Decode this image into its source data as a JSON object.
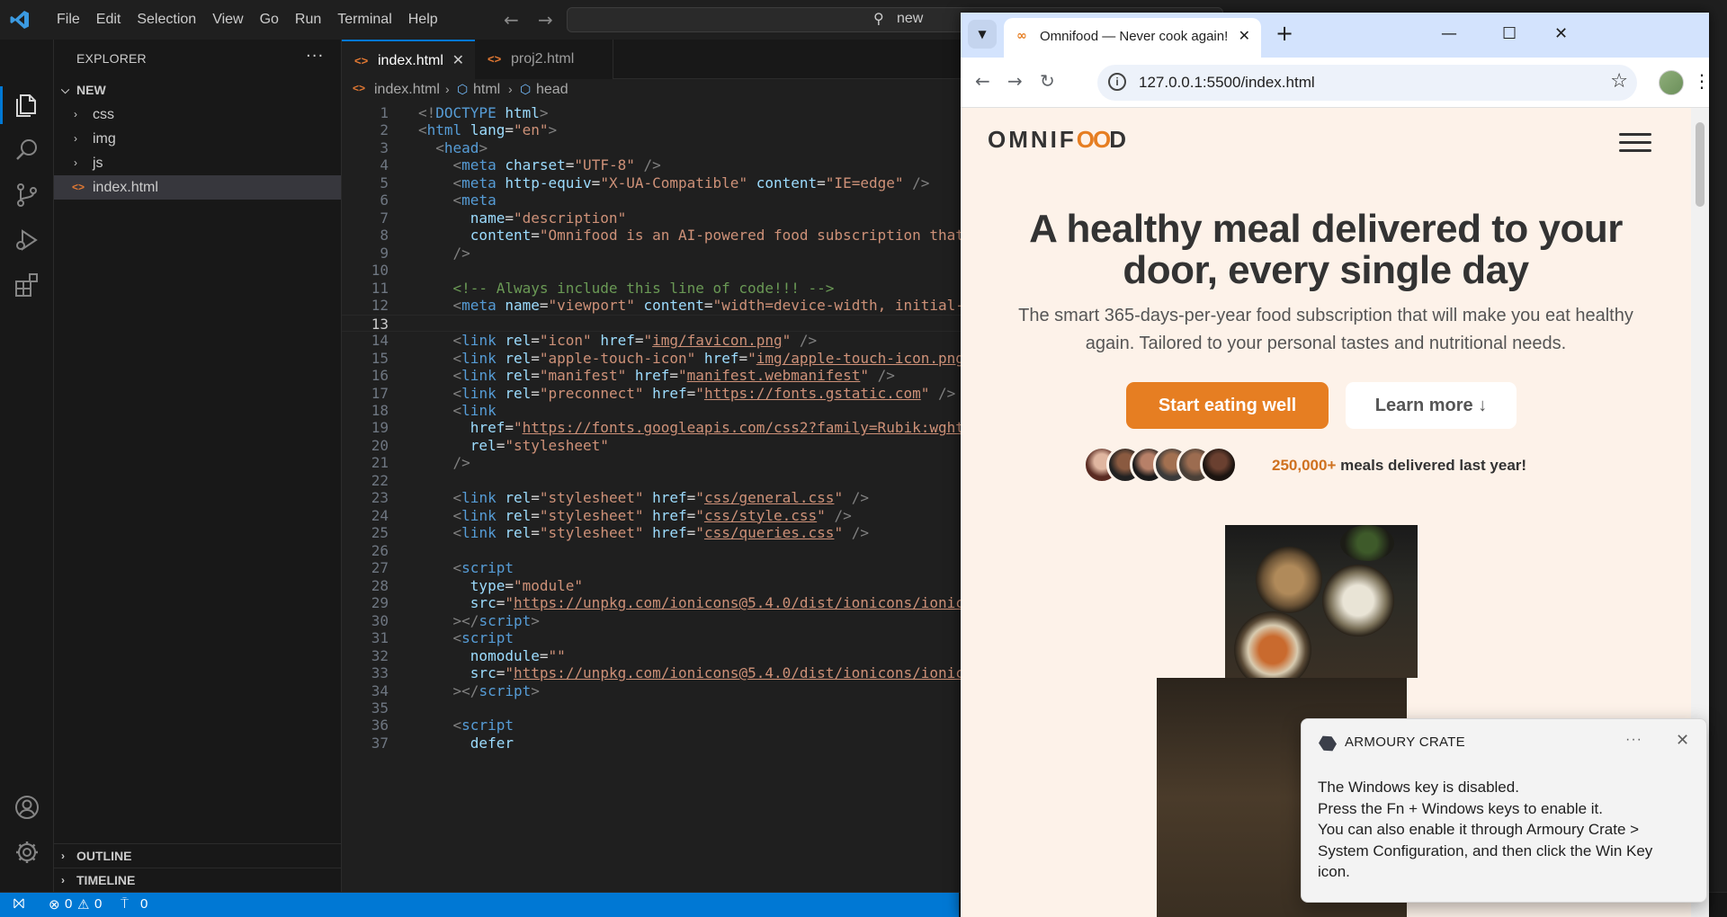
{
  "vscode": {
    "menu": [
      "File",
      "Edit",
      "Selection",
      "View",
      "Go",
      "Run",
      "Terminal",
      "Help"
    ],
    "search_text": "new",
    "explorer_title": "EXPLORER",
    "explorer_more": "···",
    "root_folder": "NEW",
    "tree": [
      {
        "label": "css",
        "type": "folder"
      },
      {
        "label": "img",
        "type": "folder"
      },
      {
        "label": "js",
        "type": "folder"
      },
      {
        "label": "index.html",
        "type": "file"
      }
    ],
    "outline": "OUTLINE",
    "timeline": "TIMELINE",
    "tabs": [
      {
        "label": "index.html",
        "active": true
      },
      {
        "label": "proj2.html",
        "active": false
      }
    ],
    "breadcrumb": [
      "index.html",
      "html",
      "head"
    ],
    "current_line": 13,
    "status": {
      "errors": "0",
      "warnings": "0",
      "ports": "0"
    }
  },
  "browser": {
    "tab_title": "Omnifood — Never cook again!",
    "url": "127.0.0.1:5500/index.html",
    "page": {
      "logo_left": "OMNIF",
      "logo_oo": "OO",
      "logo_right": "D",
      "hero_title": "A healthy meal delivered to your door, every single day",
      "hero_description": "The smart 365-days-per-year food subscription that will make you eat healthy again. Tailored to your personal tastes and nutritional needs.",
      "cta_primary": "Start eating well",
      "cta_secondary": "Learn more ↓",
      "delivered_number": "250,000+",
      "delivered_text": " meals delivered last year!",
      "customer_count": 6
    }
  },
  "toast": {
    "app_name": "ARMOURY CRATE",
    "more": "···",
    "lines": [
      "The Windows key is disabled.",
      "Press the Fn + Windows keys to enable it.",
      "You can also enable it through Armoury Crate >",
      "System Configuration, and then click the Win Key",
      "icon."
    ]
  },
  "code_lines": [
    [
      [
        "t",
        "<!"
      ],
      [
        "n",
        "DOCTYPE"
      ],
      [
        "p",
        " "
      ],
      [
        "a",
        "html"
      ],
      [
        "t",
        ">"
      ]
    ],
    [
      [
        "t",
        "<"
      ],
      [
        "n",
        "html"
      ],
      [
        "p",
        " "
      ],
      [
        "a",
        "lang"
      ],
      [
        "p",
        "="
      ],
      [
        "s",
        "\"en\""
      ],
      [
        "t",
        ">"
      ]
    ],
    [
      [
        "p",
        "  "
      ],
      [
        "t",
        "<"
      ],
      [
        "n",
        "head"
      ],
      [
        "t",
        ">"
      ]
    ],
    [
      [
        "p",
        "    "
      ],
      [
        "t",
        "<"
      ],
      [
        "n",
        "meta"
      ],
      [
        "p",
        " "
      ],
      [
        "a",
        "charset"
      ],
      [
        "p",
        "="
      ],
      [
        "s",
        "\"UTF-8\""
      ],
      [
        "p",
        " "
      ],
      [
        "t",
        "/>"
      ]
    ],
    [
      [
        "p",
        "    "
      ],
      [
        "t",
        "<"
      ],
      [
        "n",
        "meta"
      ],
      [
        "p",
        " "
      ],
      [
        "a",
        "http-equiv"
      ],
      [
        "p",
        "="
      ],
      [
        "s",
        "\"X-UA-Compatible\""
      ],
      [
        "p",
        " "
      ],
      [
        "a",
        "content"
      ],
      [
        "p",
        "="
      ],
      [
        "s",
        "\"IE=edge\""
      ],
      [
        "p",
        " "
      ],
      [
        "t",
        "/>"
      ]
    ],
    [
      [
        "p",
        "    "
      ],
      [
        "t",
        "<"
      ],
      [
        "n",
        "meta"
      ]
    ],
    [
      [
        "p",
        "      "
      ],
      [
        "a",
        "name"
      ],
      [
        "p",
        "="
      ],
      [
        "s",
        "\"description\""
      ]
    ],
    [
      [
        "p",
        "      "
      ],
      [
        "a",
        "content"
      ],
      [
        "p",
        "="
      ],
      [
        "s",
        "\"Omnifood is an AI-powered food subscription that"
      ]
    ],
    [
      [
        "p",
        "    "
      ],
      [
        "t",
        "/>"
      ]
    ],
    [],
    [
      [
        "p",
        "    "
      ],
      [
        "c",
        "<!-- Always include this line of code!!! -->"
      ]
    ],
    [
      [
        "p",
        "    "
      ],
      [
        "t",
        "<"
      ],
      [
        "n",
        "meta"
      ],
      [
        "p",
        " "
      ],
      [
        "a",
        "name"
      ],
      [
        "p",
        "="
      ],
      [
        "s",
        "\"viewport\""
      ],
      [
        "p",
        " "
      ],
      [
        "a",
        "content"
      ],
      [
        "p",
        "="
      ],
      [
        "s",
        "\"width=device-width, initial-"
      ]
    ],
    [],
    [
      [
        "p",
        "    "
      ],
      [
        "t",
        "<"
      ],
      [
        "n",
        "link"
      ],
      [
        "p",
        " "
      ],
      [
        "a",
        "rel"
      ],
      [
        "p",
        "="
      ],
      [
        "s",
        "\"icon\""
      ],
      [
        "p",
        " "
      ],
      [
        "a",
        "href"
      ],
      [
        "p",
        "="
      ],
      [
        "s",
        "\""
      ],
      [
        "l",
        "img/favicon.png"
      ],
      [
        "s",
        "\""
      ],
      [
        "p",
        " "
      ],
      [
        "t",
        "/>"
      ]
    ],
    [
      [
        "p",
        "    "
      ],
      [
        "t",
        "<"
      ],
      [
        "n",
        "link"
      ],
      [
        "p",
        " "
      ],
      [
        "a",
        "rel"
      ],
      [
        "p",
        "="
      ],
      [
        "s",
        "\"apple-touch-icon\""
      ],
      [
        "p",
        " "
      ],
      [
        "a",
        "href"
      ],
      [
        "p",
        "="
      ],
      [
        "s",
        "\""
      ],
      [
        "l",
        "img/apple-touch-icon.png"
      ]
    ],
    [
      [
        "p",
        "    "
      ],
      [
        "t",
        "<"
      ],
      [
        "n",
        "link"
      ],
      [
        "p",
        " "
      ],
      [
        "a",
        "rel"
      ],
      [
        "p",
        "="
      ],
      [
        "s",
        "\"manifest\""
      ],
      [
        "p",
        " "
      ],
      [
        "a",
        "href"
      ],
      [
        "p",
        "="
      ],
      [
        "s",
        "\""
      ],
      [
        "l",
        "manifest.webmanifest"
      ],
      [
        "s",
        "\""
      ],
      [
        "p",
        " "
      ],
      [
        "t",
        "/>"
      ]
    ],
    [
      [
        "p",
        "    "
      ],
      [
        "t",
        "<"
      ],
      [
        "n",
        "link"
      ],
      [
        "p",
        " "
      ],
      [
        "a",
        "rel"
      ],
      [
        "p",
        "="
      ],
      [
        "s",
        "\"preconnect\""
      ],
      [
        "p",
        " "
      ],
      [
        "a",
        "href"
      ],
      [
        "p",
        "="
      ],
      [
        "s",
        "\""
      ],
      [
        "l",
        "https://fonts.gstatic.com"
      ],
      [
        "s",
        "\""
      ],
      [
        "p",
        " "
      ],
      [
        "t",
        "/>"
      ]
    ],
    [
      [
        "p",
        "    "
      ],
      [
        "t",
        "<"
      ],
      [
        "n",
        "link"
      ]
    ],
    [
      [
        "p",
        "      "
      ],
      [
        "a",
        "href"
      ],
      [
        "p",
        "="
      ],
      [
        "s",
        "\""
      ],
      [
        "l",
        "https://fonts.googleapis.com/css2?family=Rubik:wght"
      ]
    ],
    [
      [
        "p",
        "      "
      ],
      [
        "a",
        "rel"
      ],
      [
        "p",
        "="
      ],
      [
        "s",
        "\"stylesheet\""
      ]
    ],
    [
      [
        "p",
        "    "
      ],
      [
        "t",
        "/>"
      ]
    ],
    [],
    [
      [
        "p",
        "    "
      ],
      [
        "t",
        "<"
      ],
      [
        "n",
        "link"
      ],
      [
        "p",
        " "
      ],
      [
        "a",
        "rel"
      ],
      [
        "p",
        "="
      ],
      [
        "s",
        "\"stylesheet\""
      ],
      [
        "p",
        " "
      ],
      [
        "a",
        "href"
      ],
      [
        "p",
        "="
      ],
      [
        "s",
        "\""
      ],
      [
        "l",
        "css/general.css"
      ],
      [
        "s",
        "\""
      ],
      [
        "p",
        " "
      ],
      [
        "t",
        "/>"
      ]
    ],
    [
      [
        "p",
        "    "
      ],
      [
        "t",
        "<"
      ],
      [
        "n",
        "link"
      ],
      [
        "p",
        " "
      ],
      [
        "a",
        "rel"
      ],
      [
        "p",
        "="
      ],
      [
        "s",
        "\"stylesheet\""
      ],
      [
        "p",
        " "
      ],
      [
        "a",
        "href"
      ],
      [
        "p",
        "="
      ],
      [
        "s",
        "\""
      ],
      [
        "l",
        "css/style.css"
      ],
      [
        "s",
        "\""
      ],
      [
        "p",
        " "
      ],
      [
        "t",
        "/>"
      ]
    ],
    [
      [
        "p",
        "    "
      ],
      [
        "t",
        "<"
      ],
      [
        "n",
        "link"
      ],
      [
        "p",
        " "
      ],
      [
        "a",
        "rel"
      ],
      [
        "p",
        "="
      ],
      [
        "s",
        "\"stylesheet\""
      ],
      [
        "p",
        " "
      ],
      [
        "a",
        "href"
      ],
      [
        "p",
        "="
      ],
      [
        "s",
        "\""
      ],
      [
        "l",
        "css/queries.css"
      ],
      [
        "s",
        "\""
      ],
      [
        "p",
        " "
      ],
      [
        "t",
        "/>"
      ]
    ],
    [],
    [
      [
        "p",
        "    "
      ],
      [
        "t",
        "<"
      ],
      [
        "n",
        "script"
      ]
    ],
    [
      [
        "p",
        "      "
      ],
      [
        "a",
        "type"
      ],
      [
        "p",
        "="
      ],
      [
        "s",
        "\"module\""
      ]
    ],
    [
      [
        "p",
        "      "
      ],
      [
        "a",
        "src"
      ],
      [
        "p",
        "="
      ],
      [
        "s",
        "\""
      ],
      [
        "l",
        "https://unpkg.com/ionicons@5.4.0/dist/ionicons/ionic"
      ]
    ],
    [
      [
        "p",
        "    "
      ],
      [
        "t",
        "></"
      ],
      [
        "n",
        "script"
      ],
      [
        "t",
        ">"
      ]
    ],
    [
      [
        "p",
        "    "
      ],
      [
        "t",
        "<"
      ],
      [
        "n",
        "script"
      ]
    ],
    [
      [
        "p",
        "      "
      ],
      [
        "a",
        "nomodule"
      ],
      [
        "p",
        "="
      ],
      [
        "s",
        "\"\""
      ]
    ],
    [
      [
        "p",
        "      "
      ],
      [
        "a",
        "src"
      ],
      [
        "p",
        "="
      ],
      [
        "s",
        "\""
      ],
      [
        "l",
        "https://unpkg.com/ionicons@5.4.0/dist/ionicons/ionic"
      ]
    ],
    [
      [
        "p",
        "    "
      ],
      [
        "t",
        "></"
      ],
      [
        "n",
        "script"
      ],
      [
        "t",
        ">"
      ]
    ],
    [],
    [
      [
        "p",
        "    "
      ],
      [
        "t",
        "<"
      ],
      [
        "n",
        "script"
      ]
    ],
    [
      [
        "p",
        "      "
      ],
      [
        "a",
        "defer"
      ]
    ]
  ]
}
